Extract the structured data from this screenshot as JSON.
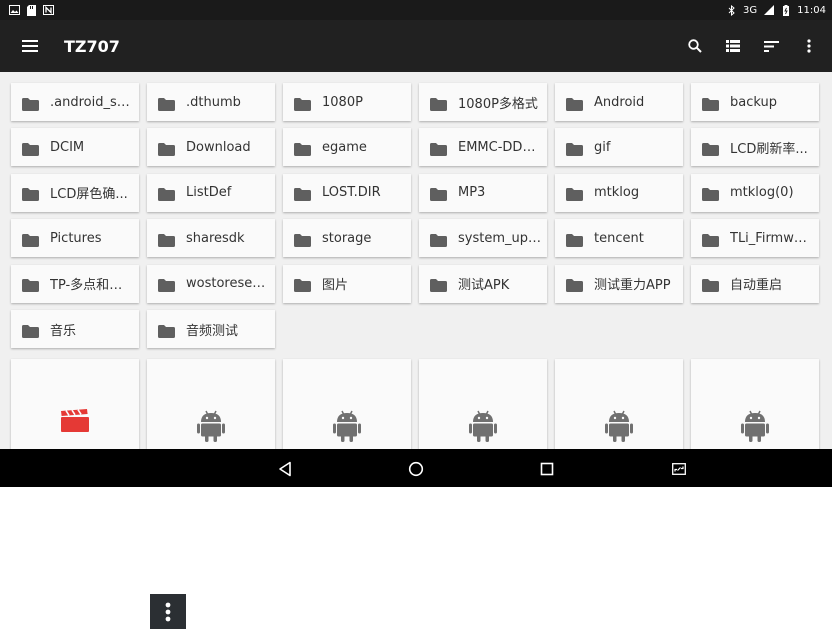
{
  "status_bar": {
    "network": "3G",
    "time": "11:04",
    "icons": [
      "image-icon",
      "sd-card-icon",
      "n-notification-icon",
      "bluetooth-icon",
      "signal-icon",
      "battery-icon"
    ]
  },
  "toolbar": {
    "title": "TZ707",
    "actions": [
      "search-icon",
      "list-view-icon",
      "sort-icon",
      "more-vert-icon"
    ]
  },
  "folders": [
    ".android_se...",
    ".dthumb",
    "1080P",
    "1080P多格式",
    "Android",
    "backup",
    "DCIM",
    "Download",
    "egame",
    "EMMC-DDR-...",
    "gif",
    "LCD刷新率...",
    "LCD屏色确...",
    "ListDef",
    "LOST.DIR",
    "MP3",
    "mtklog",
    "mtklog(0)",
    "Pictures",
    "sharesdk",
    "storage",
    "system_upd...",
    "tencent",
    "TLi_Firmwar...",
    "TP-多点和屏...",
    "wostoresec...",
    "图片",
    "测试APK",
    "测试重力APP",
    "自动重启",
    "音乐",
    "音频测试"
  ],
  "files": [
    {
      "icon": "video-clapper-icon"
    },
    {
      "icon": "android-apk-icon"
    },
    {
      "icon": "android-apk-icon"
    },
    {
      "icon": "android-apk-icon"
    },
    {
      "icon": "android-apk-icon"
    },
    {
      "icon": "android-apk-icon"
    }
  ],
  "nav_bar": [
    "back-icon",
    "home-icon",
    "recents-icon",
    "screenshot-icon"
  ],
  "colors": {
    "toolbar": "#212121",
    "content_bg": "#f0f0f0",
    "card_bg": "#fafafa",
    "folder_icon": "#5f5f5f",
    "video_icon": "#e53935",
    "android_icon": "#707070"
  }
}
